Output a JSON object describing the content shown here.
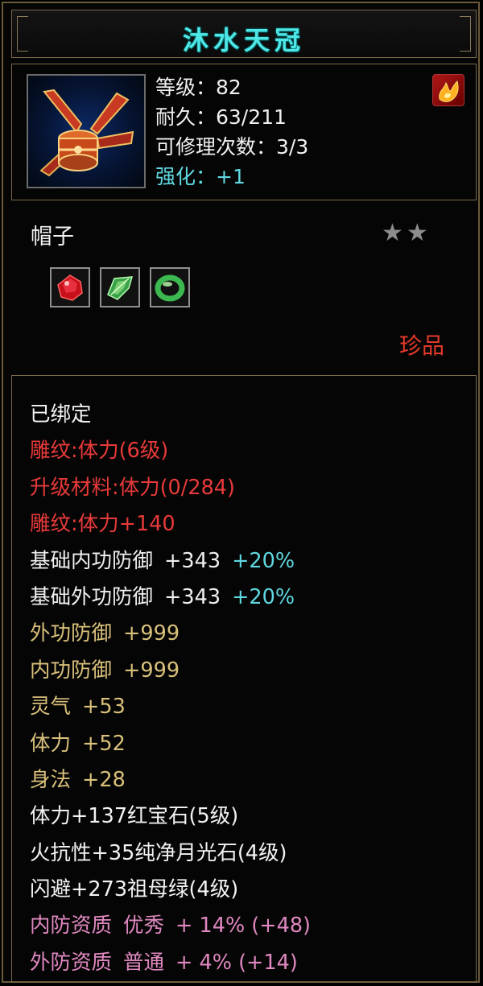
{
  "title": "沐水天冠",
  "header": {
    "level": "等级：82",
    "durability": "耐久：63/211",
    "repair": "可修理次数：3/3",
    "enhance": "强化：+1",
    "icon": "crown-helmet-icon",
    "badge_icon": "fire-element-icon"
  },
  "item_type": "帽子",
  "stars": "★★",
  "gems": [
    "ruby-gem-icon",
    "emerald-shard-icon",
    "jade-ring-gem-icon"
  ],
  "rarity": "珍品",
  "attributes": {
    "bound": "已绑定",
    "engrave1": "雕纹:体力(6级)",
    "upgrade": "升级材料:体力(0/284)",
    "engrave2": "雕纹:体力+140",
    "base_inner": {
      "label": "基础内功防御",
      "value": "+343",
      "pct": "+20%"
    },
    "base_outer": {
      "label": "基础外功防御",
      "value": "+343",
      "pct": "+20%"
    },
    "outer_def": {
      "label": "外功防御",
      "value": "+999"
    },
    "inner_def": {
      "label": "内功防御",
      "value": "+999"
    },
    "spirit": {
      "label": "灵气",
      "value": "+53"
    },
    "stamina": {
      "label": "体力",
      "value": "+52"
    },
    "agility": {
      "label": "身法",
      "value": "+28"
    },
    "gem1": "体力+137红宝石(5级)",
    "gem2": "火抗性+35纯净月光石(4级)",
    "gem3": "闪避+273祖母绿(4级)",
    "quality_inner": {
      "label": "内防资质",
      "grade": "优秀",
      "value": "+ 14% (+48)"
    },
    "quality_outer": {
      "label": "外防资质",
      "grade": "普通",
      "value": "+ 4% (+14)"
    }
  },
  "colors": {
    "title": "#4fe6e6",
    "border": "#7a6a4a",
    "red": "#e83a3a",
    "gold": "#d9c07a",
    "pink": "#e088c0",
    "cyan": "#5fd8e0"
  }
}
